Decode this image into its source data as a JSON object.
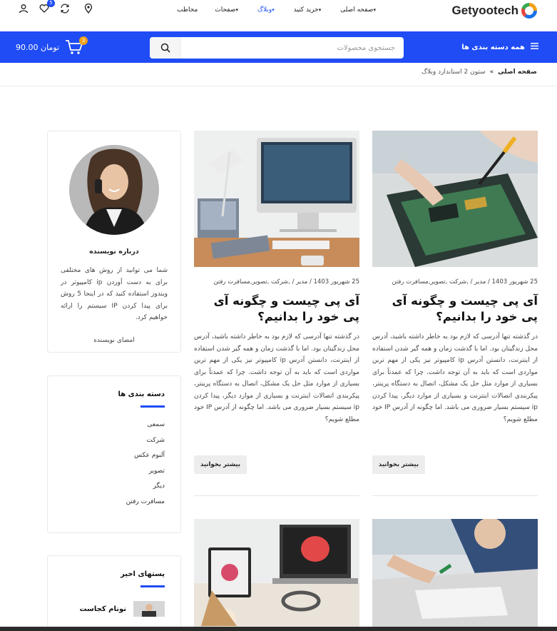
{
  "header": {
    "logo_text": "Getyootech",
    "nav": [
      {
        "label": "صفحه اصلی",
        "has_dropdown": true
      },
      {
        "label": "خرید کنید",
        "has_dropdown": true
      },
      {
        "label": "وبلاگ",
        "has_dropdown": true,
        "active": true
      },
      {
        "label": "صفحات",
        "has_dropdown": true
      },
      {
        "label": "مخاطب",
        "has_dropdown": false
      }
    ],
    "wishlist_count": "5",
    "icons": [
      "location-icon",
      "compare-icon",
      "heart-icon",
      "user-icon"
    ]
  },
  "bar": {
    "all_categories": "همه دسته بندی ها",
    "search_placeholder": "جستجوی محصولات",
    "cart_total": "90.00 تومان",
    "cart_count": "3"
  },
  "breadcrumb": {
    "home": "صفحه اصلی",
    "separator": "»",
    "current": "ستون 2 استاندارد وبلاگ"
  },
  "posts": [
    {
      "meta": "25 شهریور 1403 / مدیر / ,شرکت ,تصویر,مسافرت رفتن",
      "title": "آی پی چیست و چگونه آی پی خود را بدانیم؟",
      "excerpt": "در گذشته تنها آدرسی که لازم بود به خاطر داشته باشید، آدرس محل زندگیتان بود. اما با گذشت زمان و همه گیر شدن استفاده از اینترنت، دانستن آدرس ip کامپیوتر نیز یکی از مهم ترین مواردی است که باید به آن توجه داشت. چرا که عمدتاً برای بسیاری از موارد مثل حل یک مشکل، اتصال به دستگاه پرینتر، پیکربندی اتصالات اینترنت و بسیاری از موارد دیگر، پیدا کردن ip سیستم بسیار ضروری می باشد. اما چگونه از آدرس IP خود مطلع شویم؟",
      "more": "بیشتر بخوانید"
    },
    {
      "meta": "25 شهریور 1403 / مدیر / ,شرکت ,تصویر,مسافرت رفتن",
      "title": "آی پی چیست و چگونه آی پی خود را بدانیم؟",
      "excerpt": "در گذشته تنها آدرسی که لازم بود به خاطر داشته باشید، آدرس محل زندگیتان بود. اما با گذشت زمان و همه گیر شدن استفاده از اینترنت، دانستن آدرس ip کامپیوتر نیز یکی از مهم ترین مواردی است که باید به آن توجه داشت. چرا که عمدتاً برای بسیاری از موارد مثل حل یک مشکل، اتصال به دستگاه پرینتر، پیکربندی اتصالات اینترنت و بسیاری از موارد دیگر، پیدا کردن ip سیستم بسیار ضروری می باشد. اما چگونه از آدرس IP خود مطلع شویم؟",
      "more": "بیشتر بخوانید"
    }
  ],
  "sidebar": {
    "author": {
      "title": "درباره نویسنده",
      "bio": "شما می توانید از روش های مختلفی برای به دست آوردن ip کامپیوتر در ویندوز استفاده کنید که در اینجا 5 روش برای پیدا کردن IP سیستم را ارائه خواهیم کرد.",
      "signature": "امضای نویسنده"
    },
    "categories": {
      "title": "دسته بندی ها",
      "items": [
        "سمعی",
        "شرکت",
        "آلبوم عکس",
        "تصویر",
        "دیگر",
        "مسافرت رفتن"
      ]
    },
    "recent": {
      "title": "پستهای اخیر",
      "first_post": "نونام کجاست"
    }
  },
  "colors": {
    "accent": "#1f4cf5",
    "cart_badge": "#f0a019"
  }
}
